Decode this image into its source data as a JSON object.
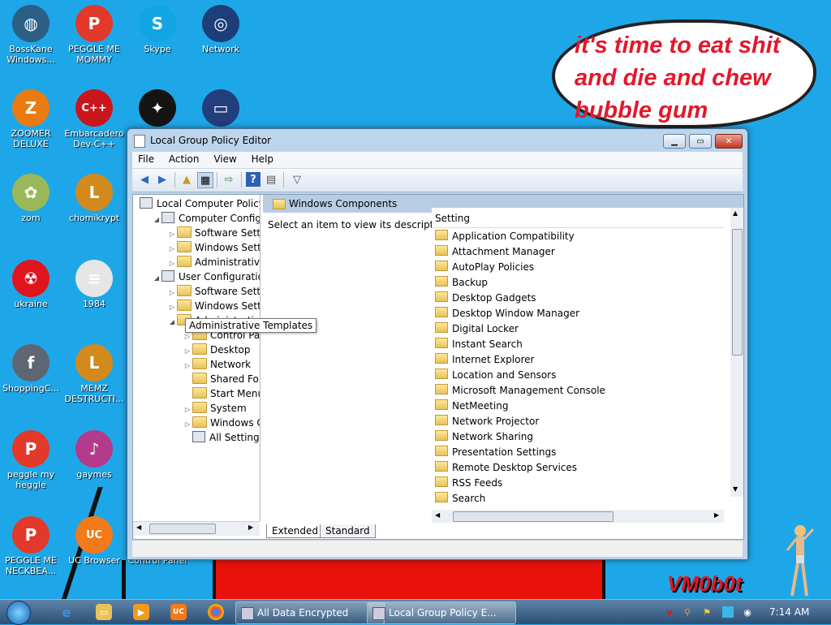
{
  "desktop": {
    "bubble_text": "it's time to eat shit and die and chew bubble gum",
    "logo_text": "VM0b0t",
    "icons": [
      {
        "label": "BossKane Windows...",
        "icon": "bosskane-icon",
        "color": "#2b5f86",
        "glyph": "◍"
      },
      {
        "label": "PEGGLE ME MOMMY",
        "icon": "peggle-icon",
        "color": "#e3392a",
        "glyph": "P"
      },
      {
        "label": "Skype",
        "icon": "skype-icon",
        "color": "#12a5e3",
        "glyph": "S"
      },
      {
        "label": "Network",
        "icon": "network-icon",
        "color": "#1c3f7a",
        "glyph": "◎"
      },
      {
        "label": "ZOOMER DELUXE",
        "icon": "zoomer-icon",
        "color": "#e87c12",
        "glyph": "Z"
      },
      {
        "label": "Embarcadero Dev-C++",
        "icon": "devcpp-icon",
        "color": "#c8161c",
        "glyph": "C++"
      },
      {
        "label": "",
        "icon": "red-black-icon",
        "color": "#141414",
        "glyph": "✦"
      },
      {
        "label": "",
        "icon": "monitor-icon",
        "color": "#233e7c",
        "glyph": "▭"
      },
      {
        "label": "zom",
        "icon": "flower-icon",
        "color": "#9ab85a",
        "glyph": "✿"
      },
      {
        "label": "chomikrypt",
        "icon": "chomikrypt-icon",
        "color": "#d38a1c",
        "glyph": "L"
      },
      {
        "label": "ukraine",
        "icon": "radiation-icon",
        "color": "#e0141c",
        "glyph": "☢"
      },
      {
        "label": "1984",
        "icon": "text-file-icon",
        "color": "#e6e6e6",
        "glyph": "≡"
      },
      {
        "label": "ShoppingC...",
        "icon": "flash-icon",
        "color": "#5d6672",
        "glyph": "f"
      },
      {
        "label": "MEMZ DESTRUCTI...",
        "icon": "memz-icon",
        "color": "#d38a1c",
        "glyph": "L"
      },
      {
        "label": "peggle my heggle",
        "icon": "peggle-icon",
        "color": "#e3392a",
        "glyph": "P"
      },
      {
        "label": "gaymes",
        "icon": "media-icon",
        "color": "#b43b8c",
        "glyph": "♪"
      },
      {
        "label": "PEGGLE ME NECKBEA...",
        "icon": "peggle-icon",
        "color": "#e3392a",
        "glyph": "P"
      },
      {
        "label": "UC Browser",
        "icon": "ucbrowser-icon",
        "color": "#f27a1a",
        "glyph": "UC"
      },
      {
        "label": "Control Panel",
        "icon": "control-panel-icon",
        "color": "#2a74c8",
        "glyph": "▤"
      }
    ]
  },
  "window": {
    "title": "Local Group Policy Editor",
    "menu": [
      "File",
      "Action",
      "View",
      "Help"
    ],
    "tree": [
      {
        "label": "Local Computer Policy",
        "indent": 0,
        "tri": "",
        "icon": "doc"
      },
      {
        "label": "Computer Configura",
        "indent": 1,
        "tri": "◢",
        "icon": "pc"
      },
      {
        "label": "Software Settings",
        "indent": 2,
        "tri": "▷",
        "icon": "folder"
      },
      {
        "label": "Windows Setting",
        "indent": 2,
        "tri": "▷",
        "icon": "folder"
      },
      {
        "label": "Administrative Templates",
        "indent": 2,
        "tri": "▷",
        "icon": "folder"
      },
      {
        "label": "User Configuration",
        "indent": 1,
        "tri": "◢",
        "icon": "pc"
      },
      {
        "label": "Software Settings",
        "indent": 2,
        "tri": "▷",
        "icon": "folder"
      },
      {
        "label": "Windows Setting",
        "indent": 2,
        "tri": "▷",
        "icon": "folder"
      },
      {
        "label": "Administrative Te",
        "indent": 2,
        "tri": "◢",
        "icon": "folder"
      },
      {
        "label": "Control Panel",
        "indent": 3,
        "tri": "▷",
        "icon": "folder"
      },
      {
        "label": "Desktop",
        "indent": 3,
        "tri": "▷",
        "icon": "folder"
      },
      {
        "label": "Network",
        "indent": 3,
        "tri": "▷",
        "icon": "folder"
      },
      {
        "label": "Shared Folder",
        "indent": 3,
        "tri": "",
        "icon": "folder"
      },
      {
        "label": "Start Menu ar",
        "indent": 3,
        "tri": "",
        "icon": "folder"
      },
      {
        "label": "System",
        "indent": 3,
        "tri": "▷",
        "icon": "folder"
      },
      {
        "label": "Windows Cor",
        "indent": 3,
        "tri": "▷",
        "icon": "folder"
      },
      {
        "label": "All Settings",
        "indent": 3,
        "tri": "",
        "icon": "settings"
      }
    ],
    "tooltip": "Administrative Templates",
    "right_header": "Windows Components",
    "description": "Select an item to view its description.",
    "column_header": "Setting",
    "settings": [
      "Application Compatibility",
      "Attachment Manager",
      "AutoPlay Policies",
      "Backup",
      "Desktop Gadgets",
      "Desktop Window Manager",
      "Digital Locker",
      "Instant Search",
      "Internet Explorer",
      "Location and Sensors",
      "Microsoft Management Console",
      "NetMeeting",
      "Network Projector",
      "Network Sharing",
      "Presentation Settings",
      "Remote Desktop Services",
      "RSS Feeds",
      "Search"
    ],
    "tabs": [
      "Extended",
      "Standard"
    ]
  },
  "taskbar": {
    "tasks": [
      "All Data Encrypted",
      "Local Group Policy E..."
    ],
    "clock": "7:14 AM"
  }
}
